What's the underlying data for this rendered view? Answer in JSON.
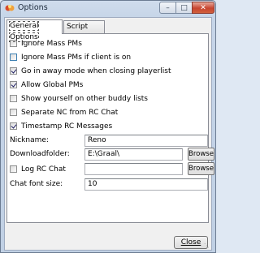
{
  "window": {
    "title": "Options"
  },
  "tabs": [
    {
      "label": "General Options",
      "active": true
    },
    {
      "label": "Script Style",
      "active": false
    }
  ],
  "checkboxes": [
    {
      "label": "Ignore Mass PMs",
      "checked": false
    },
    {
      "label": "Ignore Mass PMs if client is on",
      "checked": false
    },
    {
      "label": "Go in away mode when closing playerlist",
      "checked": true
    },
    {
      "label": "Allow Global PMs",
      "checked": true
    },
    {
      "label": "Show yourself on other buddy lists",
      "checked": false
    },
    {
      "label": "Separate NC from RC Chat",
      "checked": false
    },
    {
      "label": "Timestamp RC Messages",
      "checked": true
    }
  ],
  "fields": {
    "nickname": {
      "label": "Nickname:",
      "value": "Reno"
    },
    "downloadfolder": {
      "label": "Downloadfolder:",
      "value": "E:\\Graal\\",
      "browse_label": "Browse"
    },
    "log_rc_chat": {
      "label": "Log RC Chat",
      "checked": false,
      "value": "",
      "browse_label": "Browse"
    },
    "chat_font_size": {
      "label": "Chat font size:",
      "value": "10"
    }
  },
  "buttons": {
    "close_label": "Close"
  },
  "colors": {
    "titlebar": "#c6d5e8",
    "close_caption": "#c7442f"
  }
}
